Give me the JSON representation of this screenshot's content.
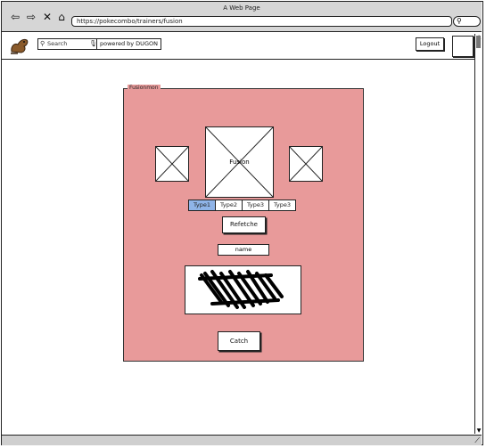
{
  "window": {
    "title": "A Web Page"
  },
  "browser": {
    "url": "https://pokecombo/trainers/fusion",
    "nav_icons": [
      "back-arrow-icon",
      "forward-arrow-icon",
      "close-x-icon",
      "home-icon"
    ]
  },
  "header": {
    "search_placeholder": "Search",
    "powered_by": "powered by DUGON",
    "logout_label": "Logout"
  },
  "fusion_panel": {
    "title": "Fusionmon",
    "main_image_label": "Fusion",
    "type_tabs": [
      "Type1",
      "Type2",
      "Type3",
      "Type3"
    ],
    "active_tab": "Type1",
    "refetch_label": "Refetche",
    "name_value": "name",
    "catch_label": "Catch"
  },
  "colors": {
    "panel_bg": "#e89a9a",
    "active_tab": "#8fb4e8",
    "chrome": "#d6d6d6"
  }
}
